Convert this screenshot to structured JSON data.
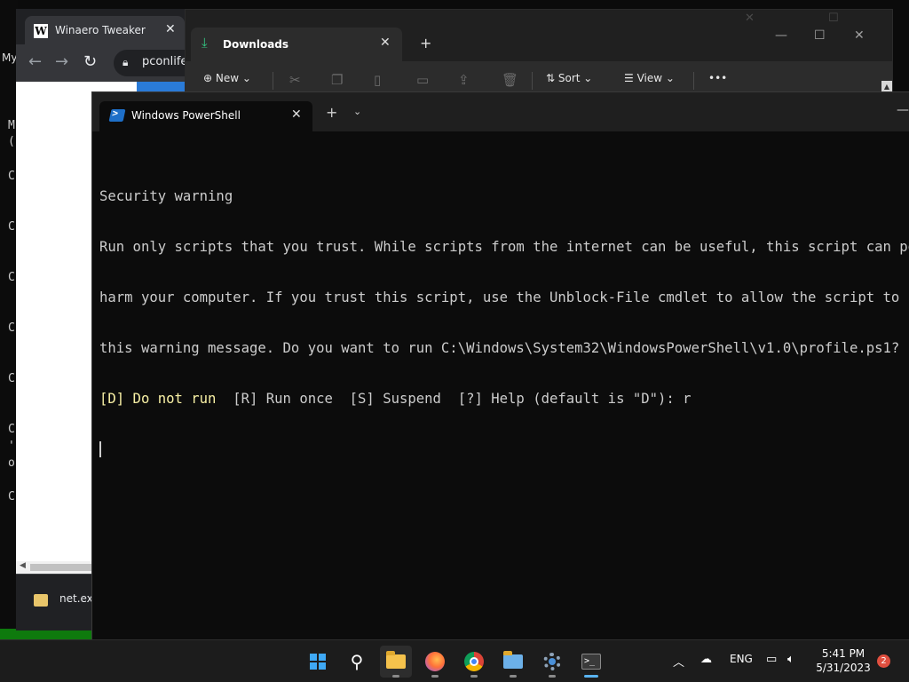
{
  "background_window": {
    "label_my": "My",
    "left_chars": [
      {
        "text": "M",
        "top": 0
      },
      {
        "text": "(",
        "top": 0
      },
      {
        "text": "C",
        "top": 0
      },
      {
        "text": "C",
        "top": 0
      },
      {
        "text": "C",
        "top": 0
      },
      {
        "text": "C",
        "top": 0
      },
      {
        "text": "C",
        "top": 0
      },
      {
        "text": "C",
        "top": 0
      },
      {
        "text": "'",
        "top": 0
      },
      {
        "text": "o",
        "top": 0
      },
      {
        "text": "C",
        "top": 0
      }
    ]
  },
  "browser": {
    "tab_title": "Winaero Tweaker",
    "favicon_letter": "W",
    "url": "pconlife",
    "download_item": "net.exe"
  },
  "explorer": {
    "tab_title": "Downloads",
    "commands": {
      "new": "New",
      "sort": "Sort",
      "view": "View",
      "more": "•••"
    }
  },
  "terminal": {
    "tab_title": "Windows PowerShell",
    "lines": {
      "heading": "Security warning",
      "l1": "Run only scripts that you trust. While scripts from the internet can be useful, this script can potent",
      "l2": "harm your computer. If you trust this script, use the Unblock-File cmdlet to allow the script to run w",
      "l3": "this warning message. Do you want to run C:\\Windows\\System32\\WindowsPowerShell\\v1.0\\profile.ps1?",
      "prompt_default": "[D] Do not run",
      "prompt_rest": "  [R] Run once  [S] Suspend  [?] Help (default is \"D\"): r"
    }
  },
  "taskbar": {
    "language": "ENG",
    "time": "5:41 PM",
    "date": "5/31/2023",
    "notification_count": "2"
  },
  "colors": {
    "terminal_bg": "#0c0c0c",
    "terminal_text": "#cccccc",
    "prompt_yellow": "#f9f1a5",
    "accent_blue": "#59b3f0"
  }
}
